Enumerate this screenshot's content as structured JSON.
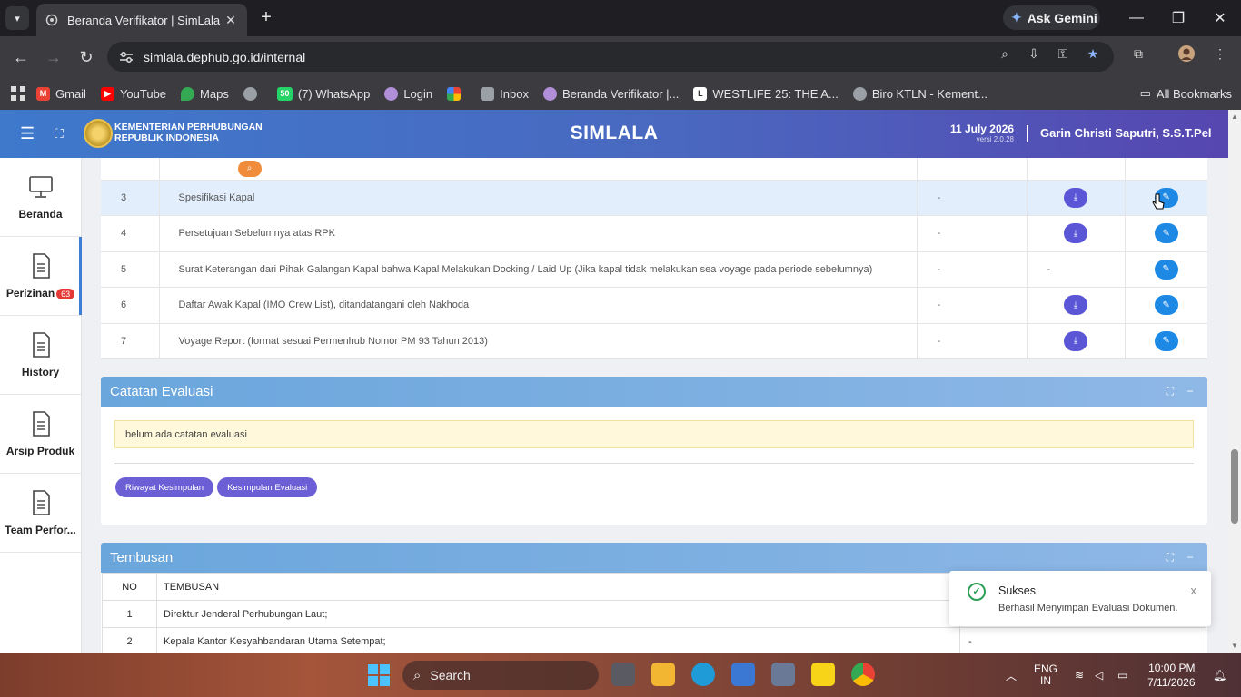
{
  "browser": {
    "tab_title": "Beranda Verifikator | SimLala",
    "tab_close": "✕",
    "new_tab": "+",
    "ask_gemini": "Ask Gemini",
    "url": "simlala.dephub.go.id/internal",
    "bookmarks": [
      {
        "label": "Gmail",
        "icon": "gmail-icon",
        "color": "#ea4335"
      },
      {
        "label": "YouTube",
        "icon": "youtube-icon",
        "color": "#ff0000"
      },
      {
        "label": "Maps",
        "icon": "maps-icon",
        "color": "#34a853"
      },
      {
        "label": "",
        "icon": "globe-icon",
        "color": "#9aa0a6"
      },
      {
        "label": "(7) WhatsApp",
        "icon": "whatsapp-icon",
        "color": "#25d366",
        "badge": "50"
      },
      {
        "label": "Login",
        "icon": "login-icon",
        "color": "#b08fd8"
      },
      {
        "label": "",
        "icon": "pinwheel-icon",
        "color": "#fbbc04"
      },
      {
        "label": "Inbox",
        "icon": "inbox-icon",
        "color": "#9aa0a6"
      },
      {
        "label": "Beranda Verifikator |...",
        "icon": "simlala-icon",
        "color": "#b08fd8"
      },
      {
        "label": "WESTLIFE 25: THE A...",
        "icon": "bookmark-l-icon",
        "color": "#ffffff"
      },
      {
        "label": "Biro KTLN - Kement...",
        "icon": "globe-icon",
        "color": "#9aa0a6"
      }
    ],
    "all_bookmarks": "All Bookmarks"
  },
  "app": {
    "ministry_line1": "KEMENTERIAN PERHUBUNGAN",
    "ministry_line2": "REPUBLIK INDONESIA",
    "brand": "SIMLALA",
    "date": "11 July 2026",
    "version": "versi 2.0.28",
    "user": "Garin Christi Saputri, S.S.T.Pel"
  },
  "sidebar": {
    "items": [
      {
        "label": "Beranda",
        "icon": "monitor-icon"
      },
      {
        "label": "Perizinan",
        "icon": "document-icon",
        "badge": "63"
      },
      {
        "label": "History",
        "icon": "document-icon"
      },
      {
        "label": "Arsip Produk",
        "icon": "document-icon"
      },
      {
        "label": "Team Perfor...",
        "icon": "document-icon"
      }
    ]
  },
  "documents": {
    "rows": [
      {
        "no": "3",
        "name": "Spesifikasi Kapal",
        "status": "-",
        "download": true
      },
      {
        "no": "4",
        "name": "Persetujuan Sebelumnya atas RPK",
        "status": "-",
        "download": true
      },
      {
        "no": "5",
        "name": "Surat Keterangan dari Pihak Galangan Kapal bahwa Kapal Melakukan Docking / Laid Up (Jika kapal tidak melakukan sea voyage pada periode sebelumnya)",
        "status": "-",
        "download": false,
        "download_text": "-"
      },
      {
        "no": "6",
        "name": "Daftar Awak Kapal (IMO Crew List), ditandatangani oleh Nakhoda",
        "status": "-",
        "download": true
      },
      {
        "no": "7",
        "name": "Voyage Report (format sesuai Permenhub Nomor PM 93 Tahun 2013)",
        "status": "-",
        "download": true
      }
    ]
  },
  "evaluasi": {
    "title": "Catatan Evaluasi",
    "note": "belum ada catatan evaluasi",
    "btn_riwayat": "Riwayat Kesimpulan",
    "btn_kesimpulan": "Kesimpulan Evaluasi"
  },
  "tembusan": {
    "title": "Tembusan",
    "headers": [
      "NO",
      "TEMBUSAN"
    ],
    "rows": [
      {
        "no": "1",
        "name": "Direktur Jenderal Perhubungan Laut;",
        "extra": ""
      },
      {
        "no": "2",
        "name": "Kepala Kantor Kesyahbandaran Utama Setempat;",
        "extra": "-"
      }
    ]
  },
  "toast": {
    "title": "Sukses",
    "message": "Berhasil Menyimpan Evaluasi Dokumen.",
    "close": "x"
  },
  "taskbar": {
    "search": "Search",
    "lang_line1": "ENG",
    "lang_line2": "IN",
    "time": "10:00 PM",
    "date": "7/11/2026"
  },
  "colors": {
    "header_start": "#3e79cc",
    "header_end": "#5646b0",
    "download_button": "#5a56d6",
    "edit_button": "#1e88e5",
    "pill_button": "#6c5fd6",
    "success": "#2e9f57"
  }
}
